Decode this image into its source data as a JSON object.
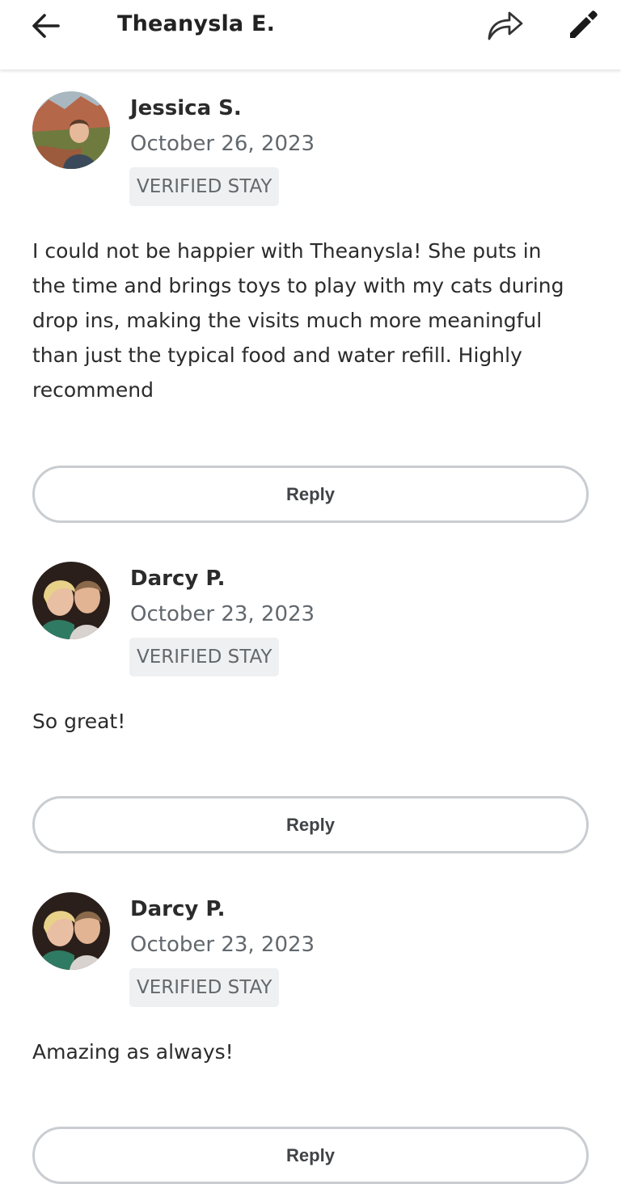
{
  "header": {
    "back_icon": "arrow-left-icon",
    "title": "Theanysla E.",
    "share_icon": "share-arrow-icon",
    "edit_icon": "pencil-icon"
  },
  "reviews": [
    {
      "name": "Jessica S.",
      "date": "October 26, 2023",
      "badge": "VERIFIED STAY",
      "text": "I could not be happier with Theanysla! She puts in the time and brings toys to play with my cats during drop ins, making the visits much more meaningful than just the typical food and water refill. Highly recommend",
      "reply_label": "Reply"
    },
    {
      "name": "Darcy P.",
      "date": "October 23, 2023",
      "badge": "VERIFIED STAY",
      "text": "So great!",
      "reply_label": "Reply"
    },
    {
      "name": "Darcy P.",
      "date": "October 23, 2023",
      "badge": "VERIFIED STAY",
      "text": "Amazing as always!",
      "reply_label": "Reply"
    }
  ],
  "colors": {
    "text_primary": "#2b2b2b",
    "text_secondary": "#62686d",
    "badge_bg": "#eff0f1",
    "button_border": "#c9cdd1"
  }
}
